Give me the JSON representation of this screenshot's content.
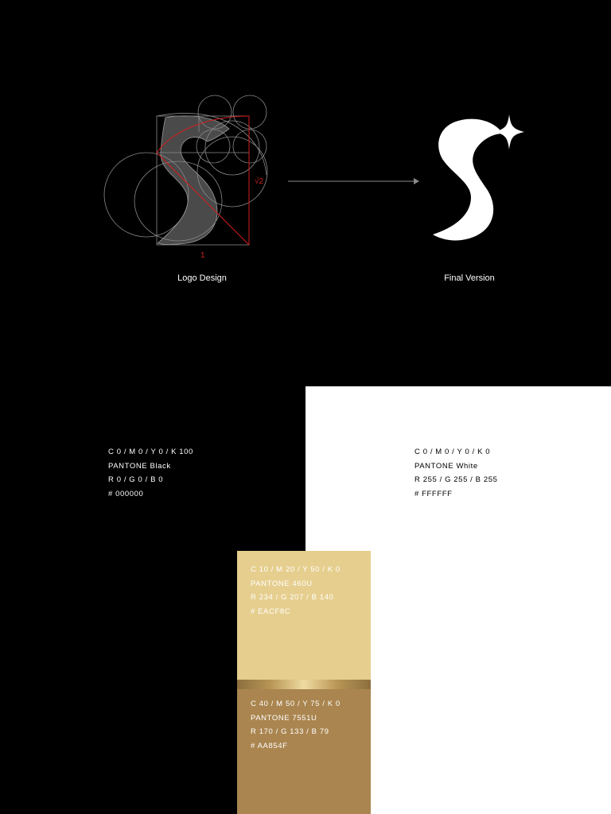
{
  "top": {
    "left_caption": "Logo Design",
    "right_caption": "Final Version",
    "construction_labels": {
      "width": "1",
      "height": "√2"
    }
  },
  "swatches": {
    "black": {
      "cmyk": "C 0 / M 0 / Y 0 / K 100",
      "pantone": "PANTONE Black",
      "rgb": "R 0 / G 0 / B 0",
      "hex": "# 000000",
      "color": "#000000"
    },
    "white": {
      "cmyk": "C 0 / M 0 / Y 0 / K 0",
      "pantone": "PANTONE White",
      "rgb": "R 255 / G 255 / B 255",
      "hex": "# FFFFFF",
      "color": "#FFFFFF"
    },
    "gold_light": {
      "cmyk": "C 10 / M 20 / Y 50 / K 0",
      "pantone": "PANTONE 460U",
      "rgb": "R 234 / G 207 / B 140",
      "hex": "# EACF8C",
      "color": "#EACF8C"
    },
    "gold_dark": {
      "cmyk": "C 40 / M 50 / Y 75 / K 0",
      "pantone": "PANTONE 7551U",
      "rgb": "R 170 / G 133 / B 79",
      "hex": "# AA854F",
      "color": "#AA854F"
    }
  }
}
